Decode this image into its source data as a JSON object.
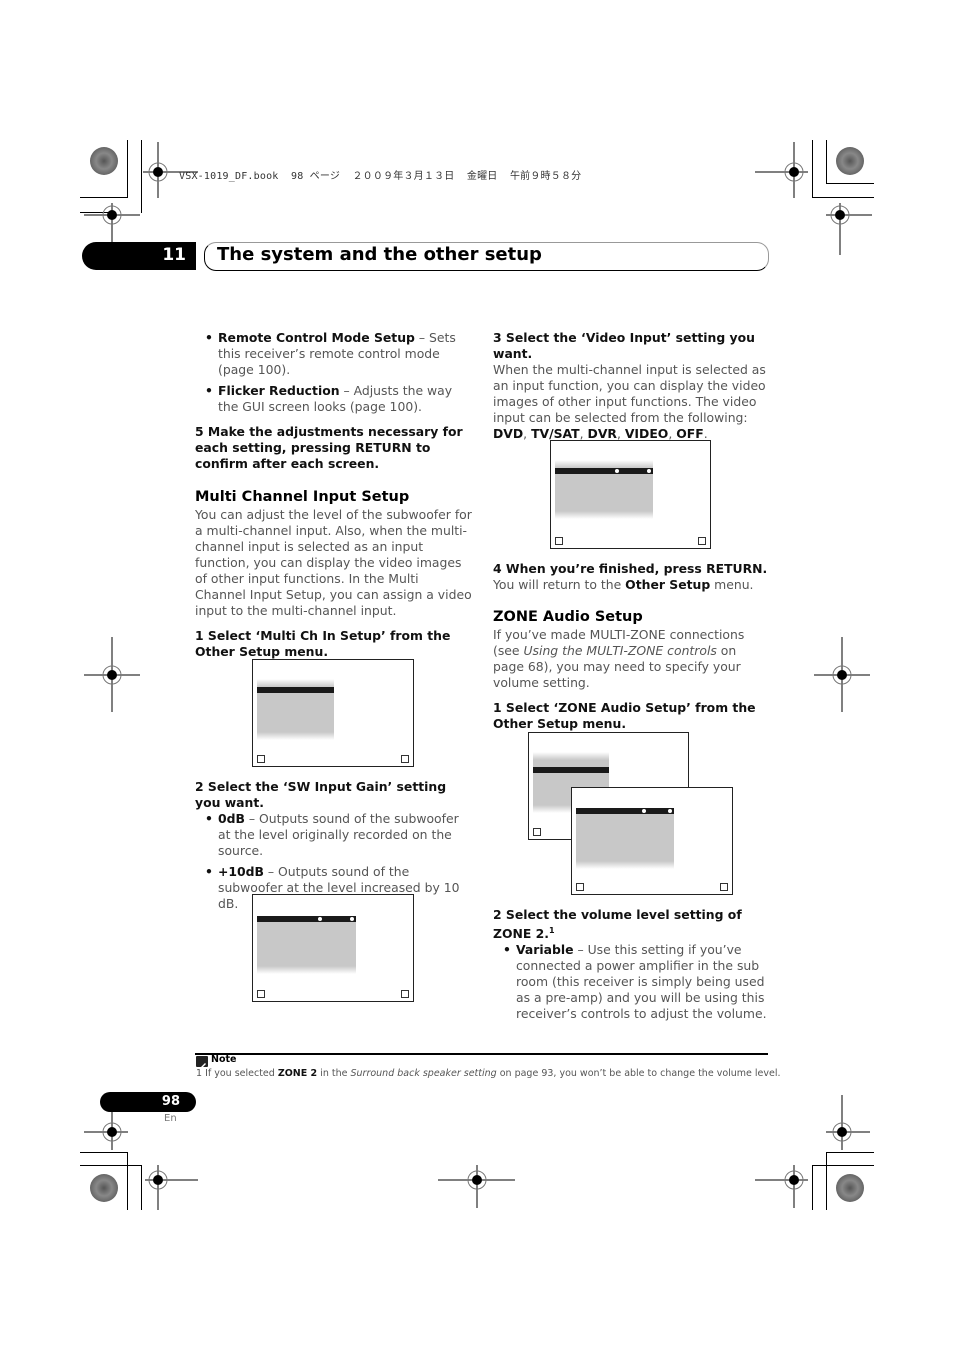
{
  "print_header": "VSX-1019_DF.book  98 ページ  ２００９年３月１３日  金曜日  午前９時５８分",
  "chapter": {
    "number": "11",
    "title": "The system and the other setup"
  },
  "left_column": {
    "bullets_top": [
      {
        "term": "Remote Control Mode Setup",
        "text": " – Sets this receiver’s remote control mode (page 100)."
      },
      {
        "term": "Flicker Reduction",
        "text": " – Adjusts the way the GUI screen looks (page 100)."
      }
    ],
    "step5": "5    Make the adjustments necessary for each setting, pressing RETURN to confirm after each screen.",
    "section_title": "Multi Channel Input Setup",
    "section_body": "You can adjust the level of the subwoofer for a multi-channel input. Also, when the multi-channel input is selected as an input function, you can display the video images of other input functions. In the Multi Channel Input Setup, you can assign a video input to the multi-channel input.",
    "step1_a": "1    Select ‘Multi Ch In Setup’ from the Other Setup",
    "step1_b": " menu.",
    "step2": "2    Select the ‘SW Input Gain’ setting you want.",
    "bullets_gain": [
      {
        "term": "0dB",
        "text": " – Outputs sound of the subwoofer at the level originally recorded on the source."
      },
      {
        "term": "+10dB",
        "text": " – Outputs sound of the subwoofer at the level increased by 10 dB."
      }
    ]
  },
  "right_column": {
    "step3": "3    Select the ‘Video Input’ setting you want.",
    "step3_body": "When the multi-channel input is selected as an input function, you can display the video images of other input functions. The video input can be selected from the following: ",
    "video_options": [
      "DVD",
      "TV/SAT",
      "DVR",
      "VIDEO",
      "OFF"
    ],
    "step4": "4    When you’re finished, press RETURN.",
    "step4_body_pre": "You will return to the ",
    "step4_body_bold": "Other Setup",
    "step4_body_post": " menu.",
    "section_title": "ZONE Audio Setup",
    "section_body_pre": "If you’ve made MULTI-ZONE connections (see ",
    "section_body_italic": "Using the MULTI-ZONE controls",
    "section_body_post": " on page 68), you may need to specify your volume setting.",
    "step1": "1    Select ‘ZONE Audio Setup’ from the Other Setup menu.",
    "step2": "2    Select the volume level setting of ZONE 2.",
    "step2_sup": "1",
    "bullet_variable": {
      "term": "Variable",
      "text": " – Use this setting if you’ve connected a power amplifier in the sub room (this receiver is simply being used as a pre-amp) and you will be using this receiver’s controls to adjust the volume."
    }
  },
  "note": {
    "label": "Note",
    "num": "1",
    "pre": " If you selected ",
    "bold": "ZONE 2",
    "mid": " in the ",
    "italic": "Surround back speaker setting",
    "post": " on page 93, you won’t be able to change the volume level."
  },
  "page": {
    "number": "98",
    "lang": "En"
  }
}
